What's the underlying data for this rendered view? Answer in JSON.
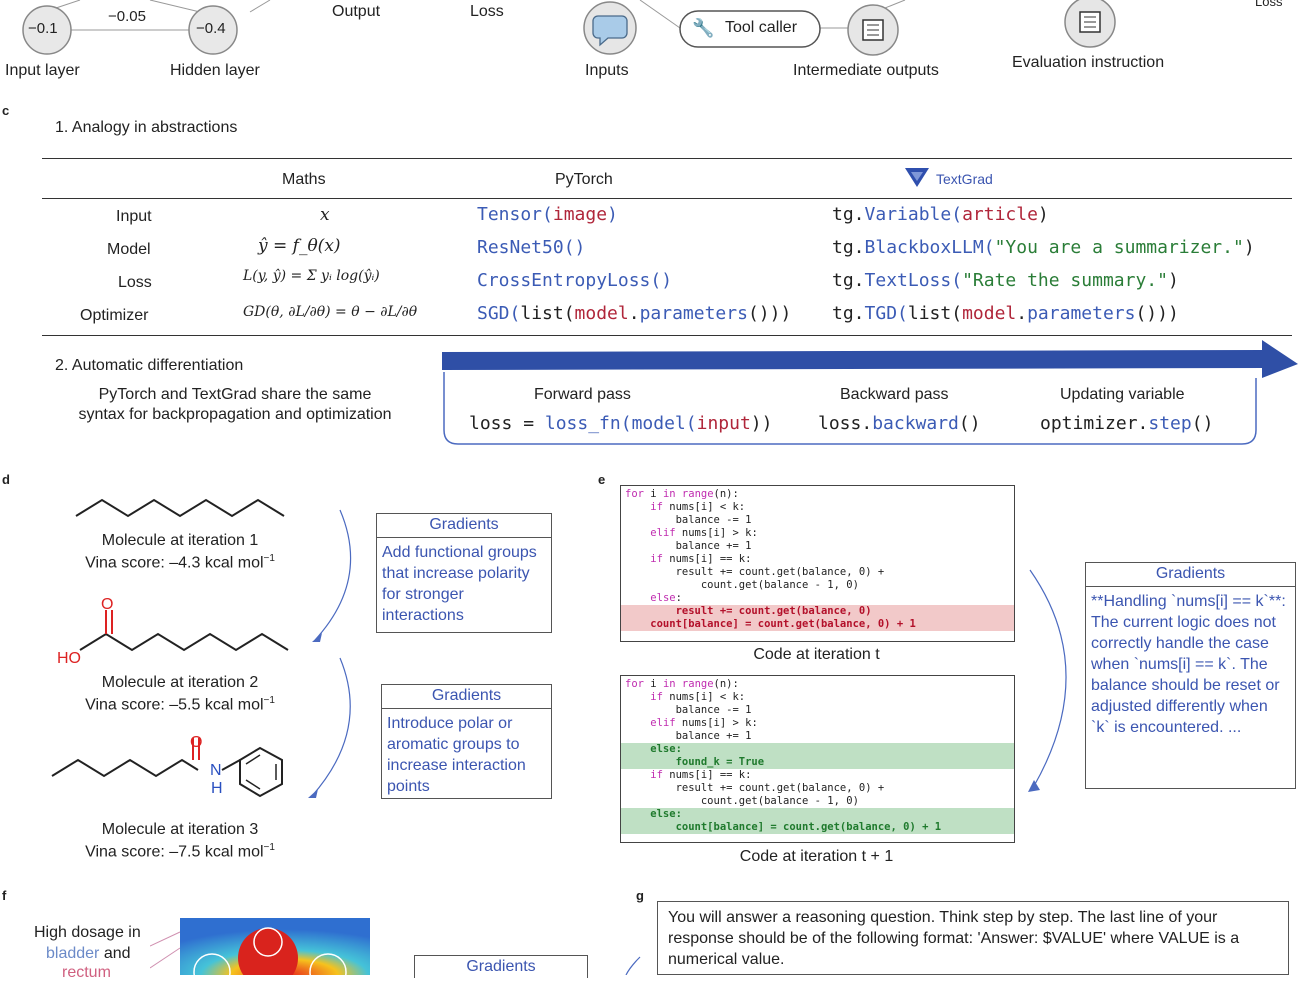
{
  "panel_a": {
    "node_left": "−0.1",
    "edge_weight": "−0.05",
    "node_right": "−0.4",
    "labels": [
      "Output",
      "Loss",
      "Input layer",
      "Hidden layer"
    ]
  },
  "panel_b": {
    "tool_caller": "Tool caller",
    "labels": [
      "Inputs",
      "Intermediate outputs",
      "Evaluation instruction",
      "Loss"
    ]
  },
  "panel_c": {
    "letter": "c",
    "section1": "1.   Analogy in abstractions",
    "columns": [
      "Maths",
      "PyTorch",
      "TextGrad"
    ],
    "rows": [
      {
        "label": "Input",
        "maths": "x",
        "pytorch": [
          [
            "Tensor(",
            "blue"
          ],
          [
            "image",
            "red"
          ],
          [
            ")",
            "blue"
          ]
        ],
        "textgrad": [
          [
            "tg.",
            "k"
          ],
          [
            "Variable(",
            "blue"
          ],
          [
            "article",
            "red"
          ],
          [
            ")",
            "k"
          ]
        ]
      },
      {
        "label": "Model",
        "maths": "ŷ = f_θ(x)",
        "pytorch": [
          [
            "ResNet50()",
            "blue"
          ]
        ],
        "textgrad": [
          [
            "tg.",
            "k"
          ],
          [
            "BlackboxLLM(",
            "blue"
          ],
          [
            "\"You are a summarizer.\"",
            "green"
          ],
          [
            ")",
            "k"
          ]
        ]
      },
      {
        "label": "Loss",
        "maths": "L(y, ŷ) = Σ yᵢ log(ŷᵢ)",
        "pytorch": [
          [
            "CrossEntropyLoss()",
            "blue"
          ]
        ],
        "textgrad": [
          [
            "tg.",
            "k"
          ],
          [
            "TextLoss(",
            "blue"
          ],
          [
            "\"Rate the summary.\"",
            "green"
          ],
          [
            ")",
            "k"
          ]
        ]
      },
      {
        "label": "Optimizer",
        "maths": "GD(θ, ∂L/∂θ) = θ − ∂L/∂θ",
        "pytorch": [
          [
            "SGD(",
            "blue"
          ],
          [
            "list(",
            "k"
          ],
          [
            "model",
            "red"
          ],
          [
            ".",
            "k"
          ],
          [
            "parameters",
            "blue"
          ],
          [
            "()))",
            "k"
          ]
        ],
        "textgrad": [
          [
            "tg.",
            "k"
          ],
          [
            "TGD(",
            "blue"
          ],
          [
            "list(",
            "k"
          ],
          [
            "model",
            "red"
          ],
          [
            ".",
            "k"
          ],
          [
            "parameters",
            "blue"
          ],
          [
            "()))",
            "k"
          ]
        ]
      }
    ],
    "section2": "2.   Automatic differentiation",
    "share_line1": "PyTorch and TextGrad share the same",
    "share_line2": "syntax for backpropagation and optimization",
    "forward_pass": "Forward pass",
    "backward_pass": "Backward pass",
    "updating_variable": "Updating variable",
    "forward_code": [
      [
        "loss",
        "k"
      ],
      [
        " = ",
        "k"
      ],
      [
        "loss_fn(",
        "blue"
      ],
      [
        "model(",
        "blue"
      ],
      [
        "input",
        "red"
      ],
      [
        "))",
        "k"
      ]
    ],
    "backward_code": [
      [
        "loss.",
        "k"
      ],
      [
        "backward",
        "blue"
      ],
      [
        "()",
        "k"
      ]
    ],
    "step_code": [
      [
        "optimizer.",
        "k"
      ],
      [
        "step",
        "blue"
      ],
      [
        "()",
        "k"
      ]
    ]
  },
  "panel_d": {
    "letter": "d",
    "mol1_line1": "Molecule at iteration 1",
    "mol1_line2": "Vina score: –4.3 kcal mol",
    "mol2_line1": "Molecule at iteration 2",
    "mol2_line2": "Vina score: –5.5 kcal mol",
    "mol3_line1": "Molecule at iteration 3",
    "mol3_line2": "Vina score: –7.5 kcal mol",
    "superscript": "−1",
    "atom_O": "O",
    "atom_HO": "HO",
    "atom_N": "N",
    "atom_H": "H",
    "gradients_header": "Gradients",
    "gradient1": "Add functional groups that increase polarity for stronger interactions",
    "gradient2": "Introduce polar or aromatic groups to increase interaction points"
  },
  "panel_e": {
    "letter": "e",
    "code_t_caption": "Code at iteration t",
    "code_t1_caption": "Code at iteration t + 1",
    "gradients_header": "Gradients",
    "gradient_text": "**Handling `nums[i] == k`**: The current logic does not correctly handle the case when `nums[i] == k`. The balance should be reset or adjusted differently when `k` is encountered. ..."
  },
  "panel_f": {
    "letter": "f",
    "line1": "High dosage in",
    "bladder": "bladder",
    "and": " and",
    "rectum": "rectum",
    "gradients_header": "Gradients"
  },
  "panel_g": {
    "letter": "g",
    "prompt": "You will answer a reasoning question. Think step by step. The last line of your response should be of the following format: 'Answer: $VALUE' where VALUE is a numerical value."
  }
}
